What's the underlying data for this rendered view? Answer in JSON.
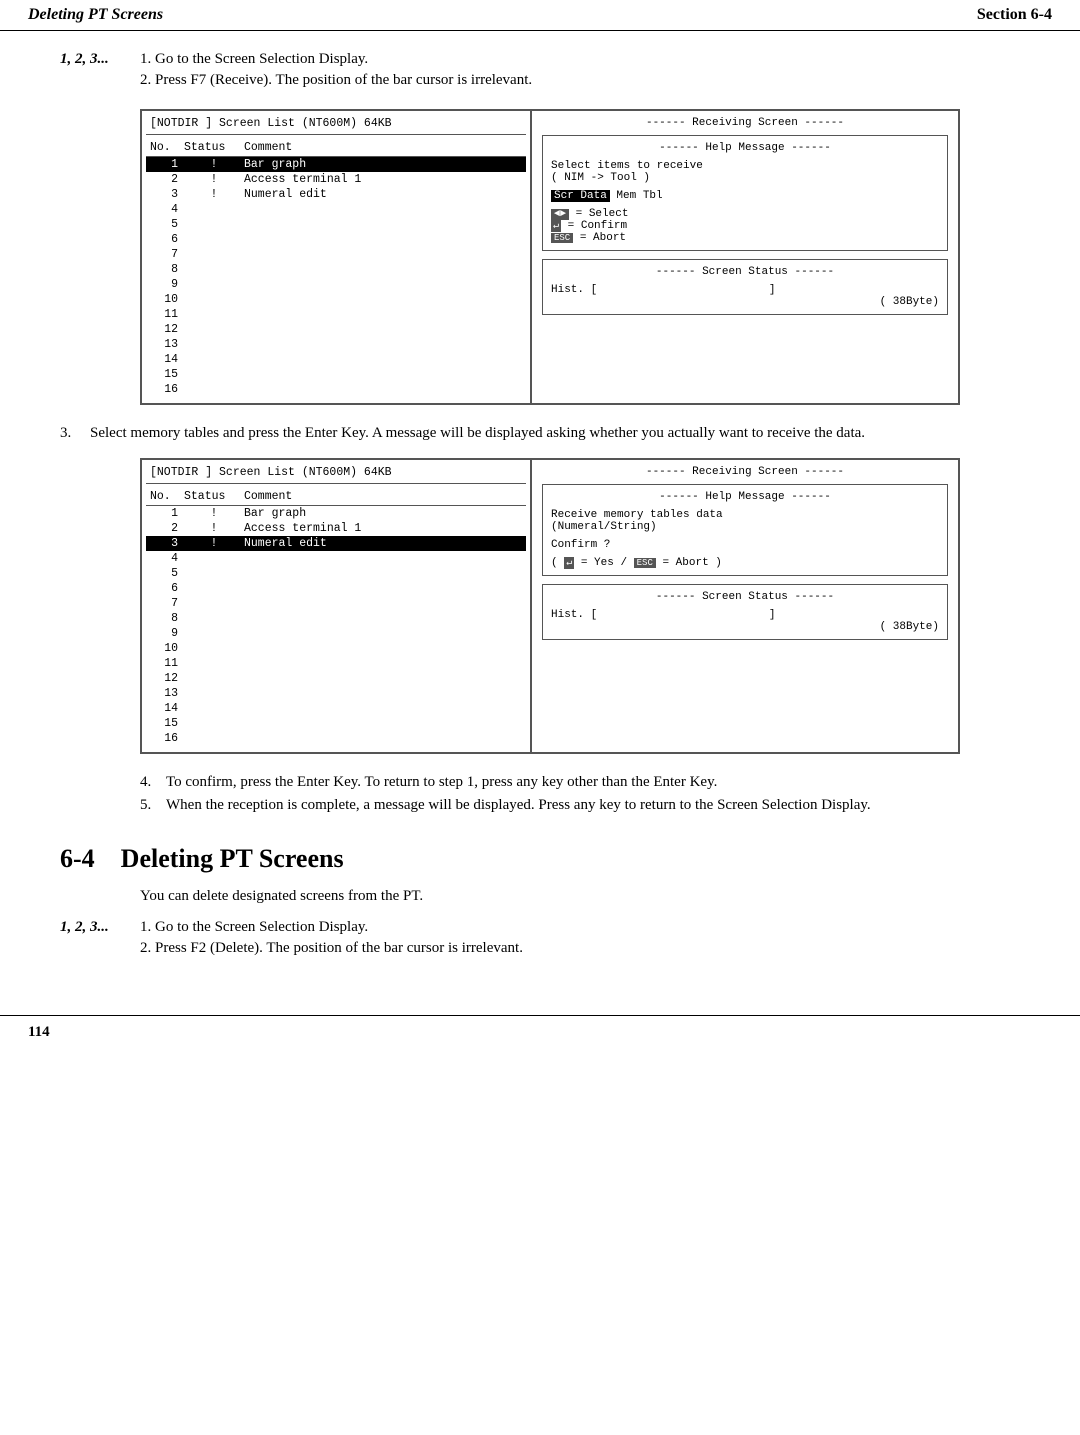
{
  "header": {
    "left": "Deleting PT Screens",
    "right": "Section 6-4"
  },
  "steps_intro": {
    "label": "1, 2, 3...",
    "step1": "1.   Go to the Screen Selection Display.",
    "step2": "2.   Press F7 (Receive). The position of the bar cursor is irrelevant."
  },
  "diagram1": {
    "header": "[NOTDIR ]  Screen List (NT600M)     64KB",
    "cols": [
      "No.",
      "Status",
      "Comment"
    ],
    "rows": [
      {
        "no": "1",
        "status": "!",
        "comment": "Bar graph",
        "selected": true
      },
      {
        "no": "2",
        "status": "!",
        "comment": "Access terminal 1",
        "selected": false
      },
      {
        "no": "3",
        "status": "!",
        "comment": "Numeral edit",
        "selected": false
      },
      {
        "no": "4",
        "status": "",
        "comment": "",
        "selected": false
      },
      {
        "no": "5",
        "status": "",
        "comment": "",
        "selected": false
      },
      {
        "no": "6",
        "status": "",
        "comment": "",
        "selected": false
      },
      {
        "no": "7",
        "status": "",
        "comment": "",
        "selected": false
      },
      {
        "no": "8",
        "status": "",
        "comment": "",
        "selected": false
      },
      {
        "no": "9",
        "status": "",
        "comment": "",
        "selected": false
      },
      {
        "no": "10",
        "status": "",
        "comment": "",
        "selected": false
      },
      {
        "no": "11",
        "status": "",
        "comment": "",
        "selected": false
      },
      {
        "no": "12",
        "status": "",
        "comment": "",
        "selected": false
      },
      {
        "no": "13",
        "status": "",
        "comment": "",
        "selected": false
      },
      {
        "no": "14",
        "status": "",
        "comment": "",
        "selected": false
      },
      {
        "no": "15",
        "status": "",
        "comment": "",
        "selected": false
      },
      {
        "no": "16",
        "status": "",
        "comment": "",
        "selected": false
      }
    ],
    "right_panel_title": "------ Receiving Screen ------",
    "help_title": "------  Help Message  ------",
    "help_text1": "Select items to receive",
    "help_text2": "( NIM -> Tool )",
    "scr_data": "Scr Data",
    "mem_tbl": "  Mem Tbl",
    "select_label": "= Select",
    "confirm_label": "= Confirm",
    "abort_label": "= Abort",
    "status_title": "------  Screen Status  ------",
    "hist_label": "Hist. [",
    "hist_end": "]",
    "byte_label": "(    38Byte)"
  },
  "step3": {
    "num": "3.",
    "text": "Select memory tables and press the Enter Key. A message will be displayed asking whether you actually want to receive the data."
  },
  "diagram2": {
    "header": "[NOTDIR ]  Screen List (NT600M)     64KB",
    "cols": [
      "No.",
      "Status",
      "Comment"
    ],
    "rows": [
      {
        "no": "1",
        "status": "!",
        "comment": "Bar graph",
        "selected": false
      },
      {
        "no": "2",
        "status": "!",
        "comment": "Access terminal 1",
        "selected": false
      },
      {
        "no": "3",
        "status": "!",
        "comment": "Numeral edit",
        "selected": true
      },
      {
        "no": "4",
        "status": "",
        "comment": "",
        "selected": false
      },
      {
        "no": "5",
        "status": "",
        "comment": "",
        "selected": false
      },
      {
        "no": "6",
        "status": "",
        "comment": "",
        "selected": false
      },
      {
        "no": "7",
        "status": "",
        "comment": "",
        "selected": false
      },
      {
        "no": "8",
        "status": "",
        "comment": "",
        "selected": false
      },
      {
        "no": "9",
        "status": "",
        "comment": "",
        "selected": false
      },
      {
        "no": "10",
        "status": "",
        "comment": "",
        "selected": false
      },
      {
        "no": "11",
        "status": "",
        "comment": "",
        "selected": false
      },
      {
        "no": "12",
        "status": "",
        "comment": "",
        "selected": false
      },
      {
        "no": "13",
        "status": "",
        "comment": "",
        "selected": false
      },
      {
        "no": "14",
        "status": "",
        "comment": "",
        "selected": false
      },
      {
        "no": "15",
        "status": "",
        "comment": "",
        "selected": false
      },
      {
        "no": "16",
        "status": "",
        "comment": "",
        "selected": false
      }
    ],
    "right_panel_title": "------ Receiving Screen ------",
    "help_title": "------  Help Message  ------",
    "help_text1": "Receive memory tables data",
    "help_text2": "(Numeral/String)",
    "confirm_question": "Confirm ?",
    "yes_abort": "( ↵ = Yes / ESC = Abort )",
    "status_title": "------  Screen Status  ------",
    "hist_label": "Hist. [",
    "hist_end": "]",
    "byte_label": "(    38Byte)"
  },
  "steps_4_5": {
    "step4_num": "4.",
    "step4_text": "To confirm, press the Enter Key. To return to step 1, press any key other than the Enter Key.",
    "step5_num": "5.",
    "step5_text": "When the reception is complete, a message will be displayed. Press any key to return to the Screen Selection Display."
  },
  "section": {
    "number": "6-4",
    "title": "Deleting PT Screens",
    "intro": "You can delete designated screens from the PT."
  },
  "steps_6_intro": {
    "label": "1, 2, 3...",
    "step1": "1.   Go to the Screen Selection Display.",
    "step2": "2.   Press F2 (Delete). The position of the bar cursor is irrelevant."
  },
  "footer": {
    "page_num": "114"
  }
}
